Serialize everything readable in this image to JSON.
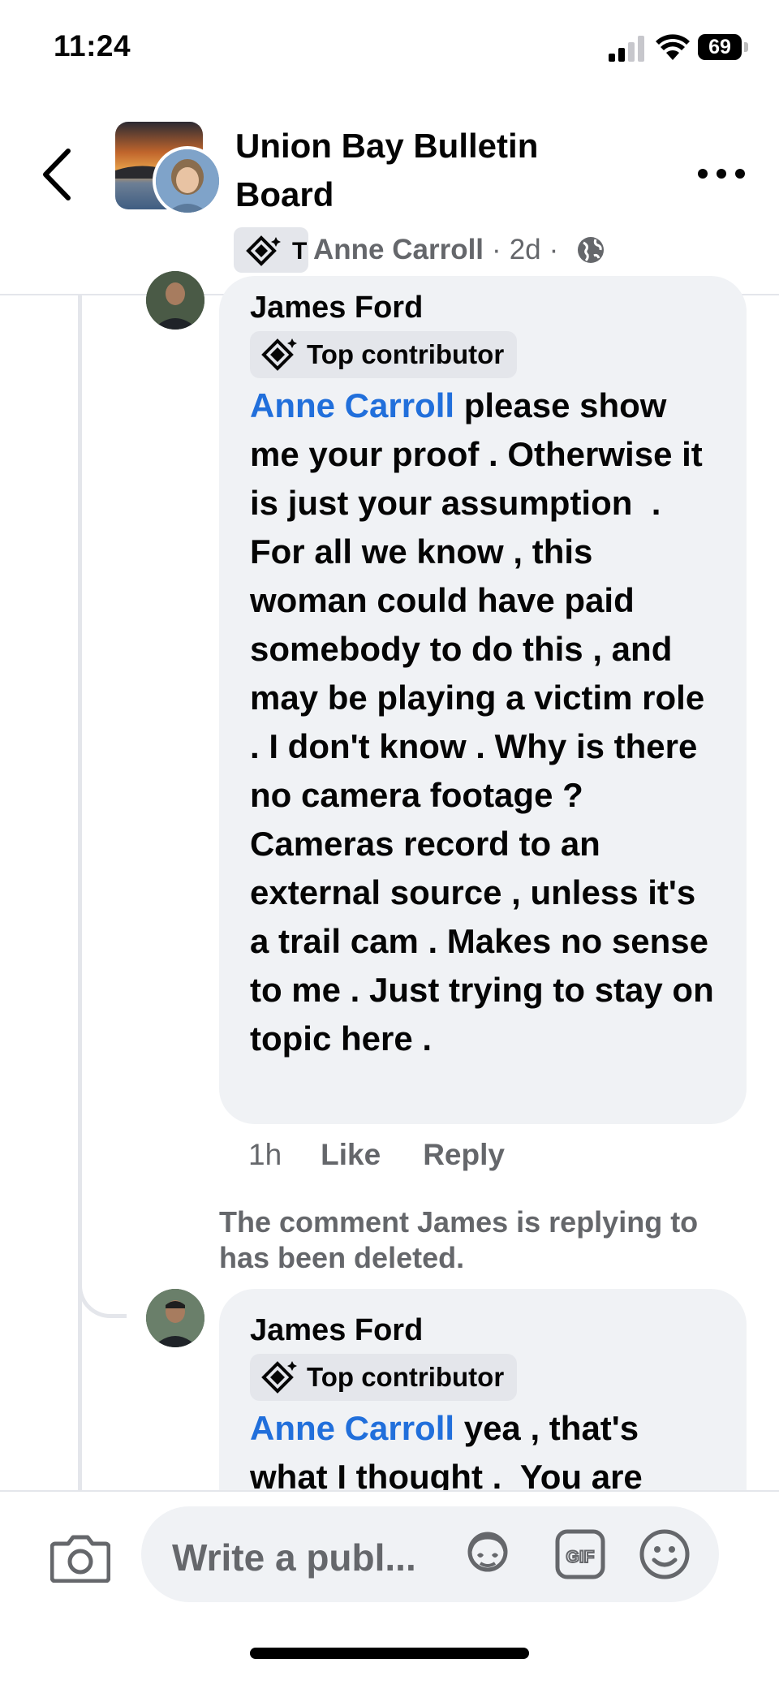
{
  "status_bar": {
    "time": "11:24",
    "battery": "69"
  },
  "header": {
    "group_name": "Union Bay Bulletin Board",
    "badge_letter": "T",
    "author": "Anne Carroll",
    "age": "2d",
    "separator": "·"
  },
  "comments": [
    {
      "author": "James Ford",
      "badge": "Top contributor",
      "mention": "Anne Carroll",
      "text": " please show me your proof . Otherwise it is just your assumption  . For all we know , this woman could have paid somebody to do this , and may be playing a victim role . I don't know . Why is there no camera footage ? Cameras record to an external source , unless it's a trail cam . Makes no sense to me . Just trying to stay on topic here .",
      "timestamp": "1h",
      "like_label": "Like",
      "reply_label": "Reply"
    },
    {
      "author": "James Ford",
      "badge": "Top contributor",
      "mention": "Anne Carroll",
      "text": " yea , that's what I thought .  You are"
    }
  ],
  "deleted_notice": "The comment James is replying to has been deleted.",
  "composer": {
    "placeholder": "Write a publ..."
  },
  "icons": [
    "back-chevron-icon",
    "more-icon",
    "globe-icon",
    "top-contributor-icon",
    "camera-icon",
    "avatar-sticker-icon",
    "gif-icon",
    "emoji-icon"
  ],
  "colors": {
    "mention": "#216fdb",
    "secondary_text": "#65676b",
    "bubble": "#f0f2f5"
  }
}
